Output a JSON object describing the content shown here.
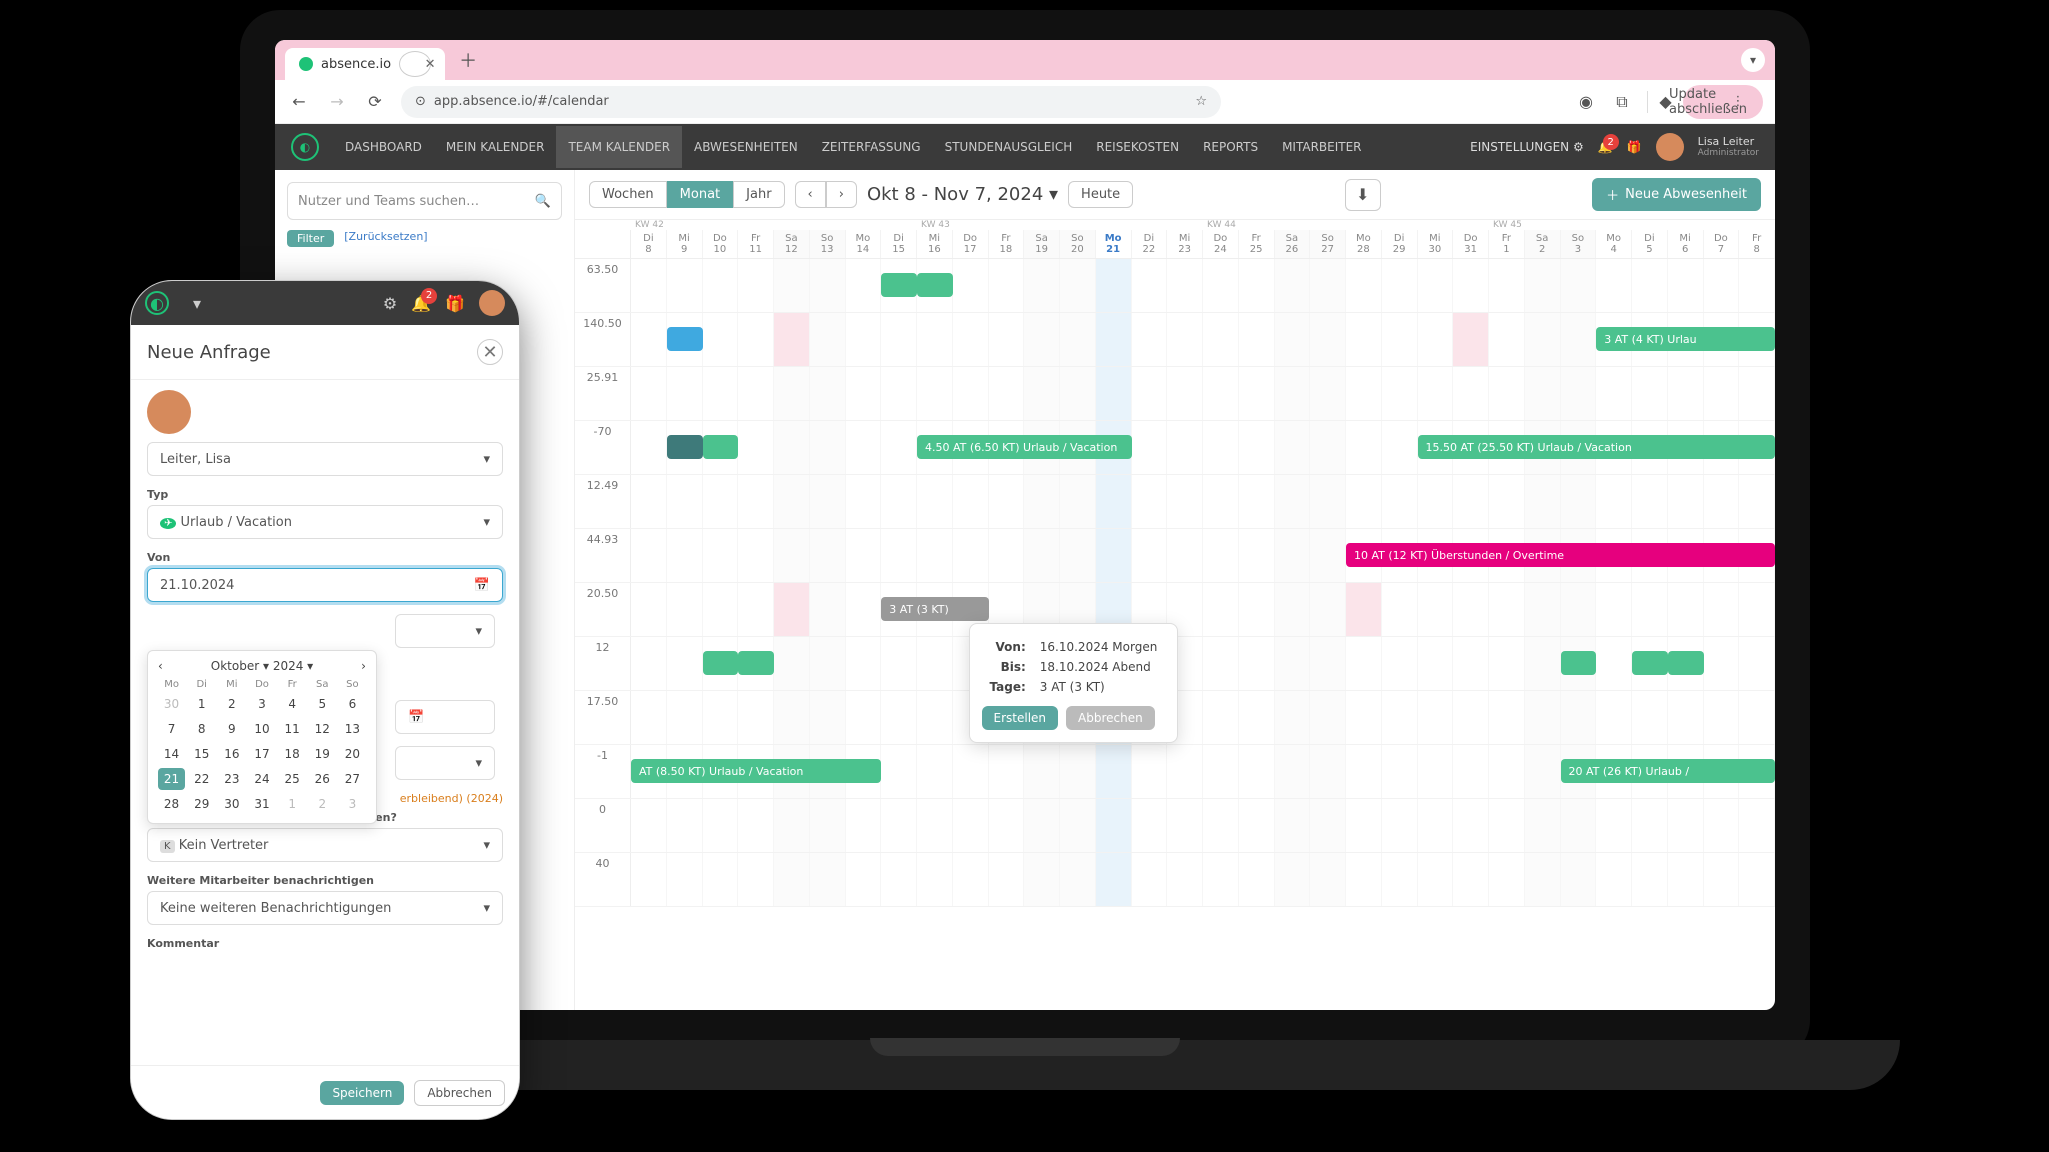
{
  "browser": {
    "tab_title": "absence.io",
    "url": "app.absence.io/#/calendar",
    "update_btn": "Update abschließen"
  },
  "nav": {
    "items": [
      "DASHBOARD",
      "MEIN KALENDER",
      "TEAM KALENDER",
      "ABWESENHEITEN",
      "ZEITERFASSUNG",
      "STUNDENAUSGLEICH",
      "REISEKOSTEN",
      "REPORTS",
      "MITARBEITER"
    ],
    "active": 2,
    "settings": "EINSTELLUNGEN",
    "badge": "2",
    "user_name": "Lisa Leiter",
    "user_role": "Administrator"
  },
  "side": {
    "search_placeholder": "Nutzer und Teams suchen…",
    "filter": "Filter",
    "reset": "[Zurücksetzen]"
  },
  "cal": {
    "view": [
      "Wochen",
      "Monat",
      "Jahr"
    ],
    "view_sel": 1,
    "title": "Okt 8 - Nov 7, 2024",
    "today": "Heute",
    "download": "⬇",
    "new_abs": "Neue Abwesenheit",
    "weeks": [
      "KW 42",
      "KW 43",
      "KW 44",
      "KW 45"
    ],
    "days_dow": [
      "Di",
      "Mi",
      "Do",
      "Fr",
      "Sa",
      "So",
      "Mo",
      "Di",
      "Mi",
      "Do",
      "Fr",
      "Sa",
      "So",
      "Mo",
      "Di",
      "Mi",
      "Do",
      "Fr",
      "Sa",
      "So",
      "Mo",
      "Di",
      "Mi",
      "Do",
      "Fr",
      "Sa",
      "So",
      "Mo",
      "Di",
      "Mi",
      "Do",
      "Fr"
    ],
    "days_num": [
      "8",
      "9",
      "10",
      "11",
      "12",
      "13",
      "14",
      "15",
      "16",
      "17",
      "18",
      "19",
      "20",
      "21",
      "22",
      "23",
      "24",
      "25",
      "26",
      "27",
      "28",
      "29",
      "30",
      "31",
      "1",
      "2",
      "3",
      "4",
      "5",
      "6",
      "7",
      "8"
    ],
    "today_idx": 13,
    "rows": [
      {
        "label": "63.50",
        "blocks": [
          {
            "cls": "g",
            "l": 7,
            "w": 1
          },
          {
            "cls": "g",
            "l": 8,
            "w": 1
          }
        ]
      },
      {
        "label": "140.50",
        "blocks": [
          {
            "cls": "b",
            "l": 1,
            "w": 1
          },
          {
            "cls": "g",
            "l": 27,
            "w": 5,
            "t": "3 AT (4 KT) Urlau"
          }
        ],
        "pink": [
          4,
          23
        ]
      },
      {
        "label": "25.91",
        "blocks": []
      },
      {
        "label": "-70",
        "blocks": [
          {
            "cls": "t",
            "l": 1,
            "w": 1
          },
          {
            "cls": "g",
            "l": 2,
            "w": 1
          },
          {
            "cls": "g",
            "l": 8,
            "w": 6,
            "t": "4.50 AT (6.50 KT) Urlaub / Vacation"
          },
          {
            "cls": "g",
            "l": 22,
            "w": 10,
            "t": "15.50 AT (25.50 KT) Urlaub / Vacation"
          }
        ]
      },
      {
        "label": "12.49",
        "blocks": []
      },
      {
        "label": "44.93",
        "blocks": [
          {
            "cls": "pk",
            "l": 20,
            "w": 12,
            "t": "10 AT (12 KT) Überstunden / Overtime"
          }
        ]
      },
      {
        "label": "20.50",
        "blocks": [
          {
            "cls": "gr",
            "l": 7,
            "w": 3,
            "t": "3 AT (3 KT)"
          }
        ],
        "pink": [
          4,
          20
        ]
      },
      {
        "label": "12",
        "blocks": [
          {
            "cls": "g",
            "l": 2,
            "w": 1
          },
          {
            "cls": "g",
            "l": 3,
            "w": 1
          },
          {
            "cls": "g",
            "l": 14,
            "w": 1
          },
          {
            "cls": "g",
            "l": 26,
            "w": 1
          },
          {
            "cls": "g",
            "l": 28,
            "w": 1
          },
          {
            "cls": "g",
            "l": 29,
            "w": 1
          }
        ]
      },
      {
        "label": "17.50",
        "blocks": []
      },
      {
        "label": "-1",
        "blocks": [
          {
            "cls": "g",
            "l": 0,
            "w": 7,
            "t": "AT (8.50 KT) Urlaub / Vacation"
          },
          {
            "cls": "g",
            "l": 26,
            "w": 6,
            "t": "20 AT (26 KT) Urlaub /"
          }
        ]
      },
      {
        "label": "0",
        "blocks": []
      },
      {
        "label": "40",
        "blocks": []
      }
    ],
    "popup": {
      "row": 6,
      "col": 9,
      "von_l": "Von:",
      "von_v": "16.10.2024 Morgen",
      "bis_l": "Bis:",
      "bis_v": "18.10.2024 Abend",
      "tage_l": "Tage:",
      "tage_v": "3 AT (3 KT)",
      "create": "Erstellen",
      "cancel": "Abbrechen"
    }
  },
  "mobile": {
    "badge": "2",
    "title": "Neue Anfrage",
    "user": "Leiter, Lisa",
    "typ_l": "Typ",
    "typ_v": "Urlaub / Vacation",
    "von_l": "Von",
    "von_v": "21.10.2024",
    "alloc": "erbleibend) (2024)",
    "sub_l": "Wer soll Deine Vertretung übernehmen?",
    "sub_v": "Kein Vertreter",
    "sub_badge": "K",
    "not_l": "Weitere Mitarbeiter benachrichtigen",
    "not_v": "Keine weiteren Benachrichtigungen",
    "com_l": "Kommentar",
    "save": "Speichern",
    "cancel": "Abbrechen",
    "dp": {
      "month": "Oktober",
      "year": "2024",
      "dow": [
        "Mo",
        "Di",
        "Mi",
        "Do",
        "Fr",
        "Sa",
        "So"
      ],
      "grid": [
        {
          "v": "30",
          "m": 1
        },
        {
          "v": "1"
        },
        {
          "v": "2"
        },
        {
          "v": "3"
        },
        {
          "v": "4"
        },
        {
          "v": "5"
        },
        {
          "v": "6"
        },
        {
          "v": "7"
        },
        {
          "v": "8"
        },
        {
          "v": "9"
        },
        {
          "v": "10"
        },
        {
          "v": "11"
        },
        {
          "v": "12"
        },
        {
          "v": "13"
        },
        {
          "v": "14"
        },
        {
          "v": "15"
        },
        {
          "v": "16"
        },
        {
          "v": "17"
        },
        {
          "v": "18"
        },
        {
          "v": "19"
        },
        {
          "v": "20"
        },
        {
          "v": "21",
          "s": 1
        },
        {
          "v": "22"
        },
        {
          "v": "23"
        },
        {
          "v": "24"
        },
        {
          "v": "25"
        },
        {
          "v": "26"
        },
        {
          "v": "27"
        },
        {
          "v": "28"
        },
        {
          "v": "29"
        },
        {
          "v": "30"
        },
        {
          "v": "31"
        },
        {
          "v": "1",
          "m": 1
        },
        {
          "v": "2",
          "m": 1
        },
        {
          "v": "3",
          "m": 1
        }
      ]
    }
  }
}
